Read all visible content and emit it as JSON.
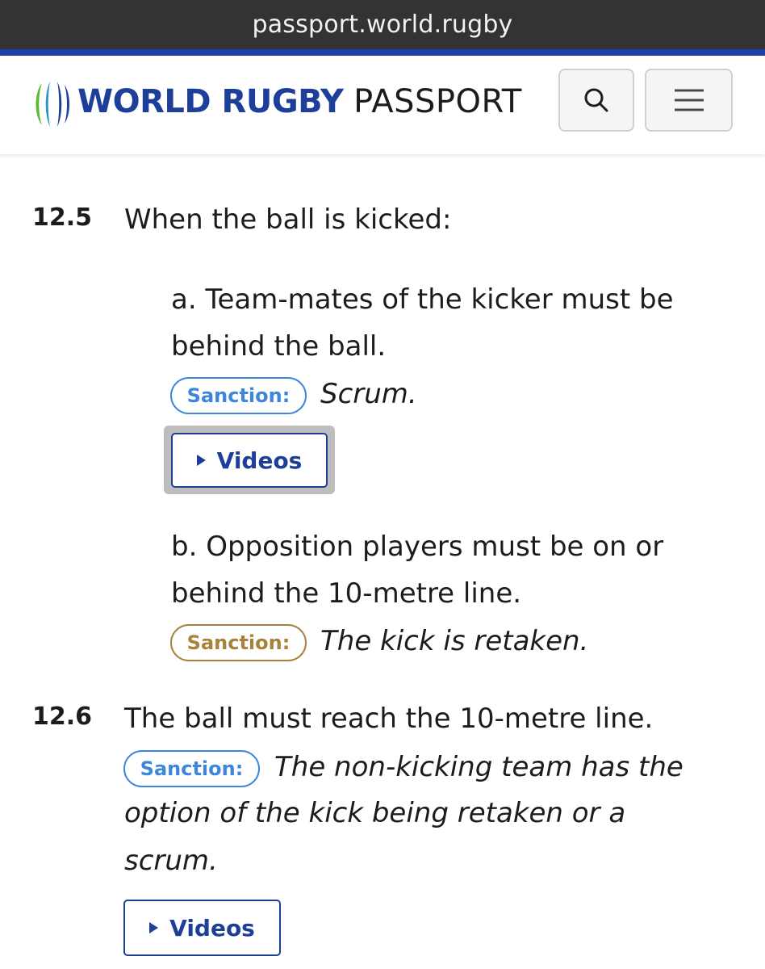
{
  "browser": {
    "url": "passport.world.rugby"
  },
  "header": {
    "brand_bold": "WORLD RUGBY",
    "brand_light": "PASSPORT",
    "logo_icon": "world-rugby-logo-icon",
    "search_icon": "search-icon",
    "menu_icon": "hamburger-menu-icon"
  },
  "colors": {
    "brand_blue": "#1e3f99",
    "badge_blue": "#3d86db",
    "badge_gold": "#a6823a",
    "url_bar": "#333333"
  },
  "law_12_5": {
    "number": "12.5",
    "heading": "When the ball is kicked:",
    "item_a": {
      "line1": "a. Team-mates of the kicker must be",
      "line2": "behind the ball.",
      "sanction_label": "Sanction:",
      "sanction_text": "Scrum.",
      "videos_label": "Videos"
    },
    "item_b": {
      "line1": "b. Opposition players must be on or",
      "line2": "behind the 10-metre line.",
      "sanction_label": "Sanction:",
      "sanction_text": "The kick is retaken."
    }
  },
  "law_12_6": {
    "number": "12.6",
    "heading": "The ball must reach the 10-metre line.",
    "sanction_label": "Sanction:",
    "sanction_line1": "The non-kicking team has the",
    "sanction_line2": "option of the kick being retaken or a",
    "sanction_line3": "scrum.",
    "videos_label": "Videos"
  }
}
